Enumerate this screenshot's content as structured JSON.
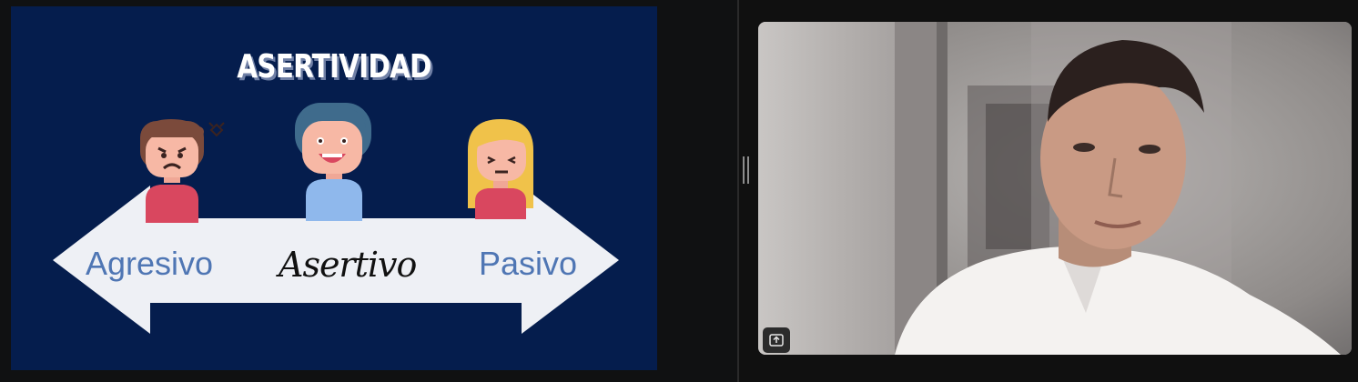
{
  "slide": {
    "title": "ASERTIVIDAD",
    "labels": {
      "left": "Agresivo",
      "center": "Asertivo",
      "right": "Pasivo"
    }
  },
  "video": {
    "participant_icon": "person-video-feed",
    "share_icon": "upload-arrow-icon"
  },
  "colors": {
    "slide_bg": "#051d4d",
    "arrow_fill": "#eef0f5",
    "label_color": "#4f76b4"
  }
}
